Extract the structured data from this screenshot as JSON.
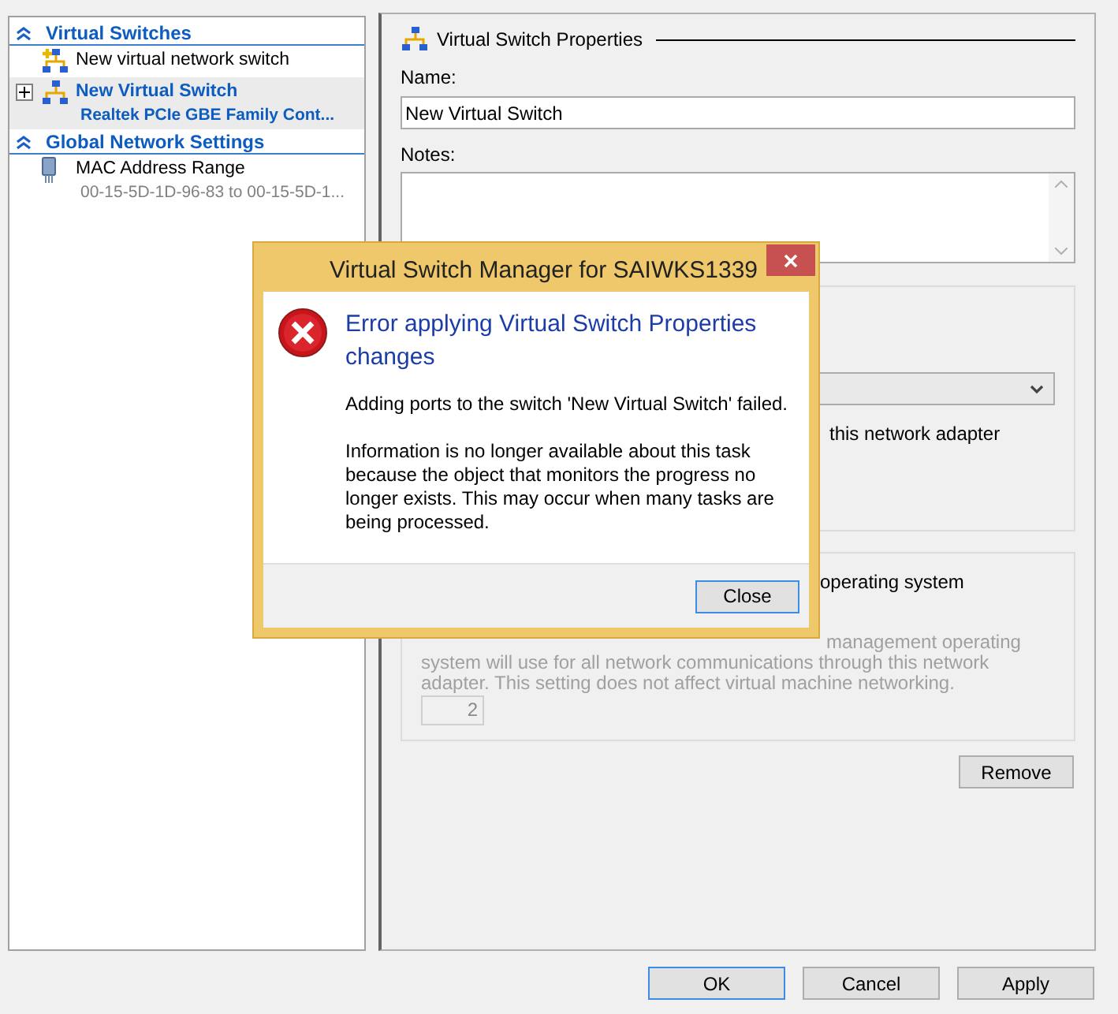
{
  "navigation": {
    "sections": [
      {
        "title": "Virtual Switches",
        "expanded": true,
        "items": [
          {
            "kind": "add-switch",
            "label": "New virtual network switch",
            "selected": false
          },
          {
            "kind": "switch",
            "label": "New Virtual Switch",
            "detail": "Realtek PCIe GBE Family Cont...",
            "selected": true,
            "expanded": false
          }
        ]
      },
      {
        "title": "Global Network Settings",
        "expanded": true,
        "items": [
          {
            "kind": "mac-range",
            "label": "MAC Address Range",
            "detail": "00-15-5D-1D-96-83 to 00-15-5D-1...",
            "selected": false
          }
        ]
      }
    ]
  },
  "properties": {
    "title": "Virtual Switch Properties",
    "name_label": "Name:",
    "name_value": "New Virtual Switch",
    "notes_label": "Notes:",
    "connection_text": "this network adapter",
    "vlan": {
      "heading": "operating system",
      "description_top": "management operating",
      "description": "system will use for all network communications through this network adapter. This setting does not affect virtual machine networking.",
      "vlan_id": "2",
      "disabled": true
    },
    "remove_button": "Remove"
  },
  "buttons": [
    {
      "label": "OK",
      "default": true
    },
    {
      "label": "Cancel",
      "default": false
    },
    {
      "label": "Apply",
      "default": false
    }
  ],
  "dialog": {
    "title": "Virtual Switch Manager for SAIWKS1339",
    "heading": "Error applying Virtual Switch Properties changes",
    "messages": [
      "Adding ports to the switch 'New Virtual Switch' failed.",
      "Information is no longer available about this task because the object that monitors the progress no longer exists. This may occur when many tasks are being processed."
    ],
    "close_button": "Close"
  }
}
